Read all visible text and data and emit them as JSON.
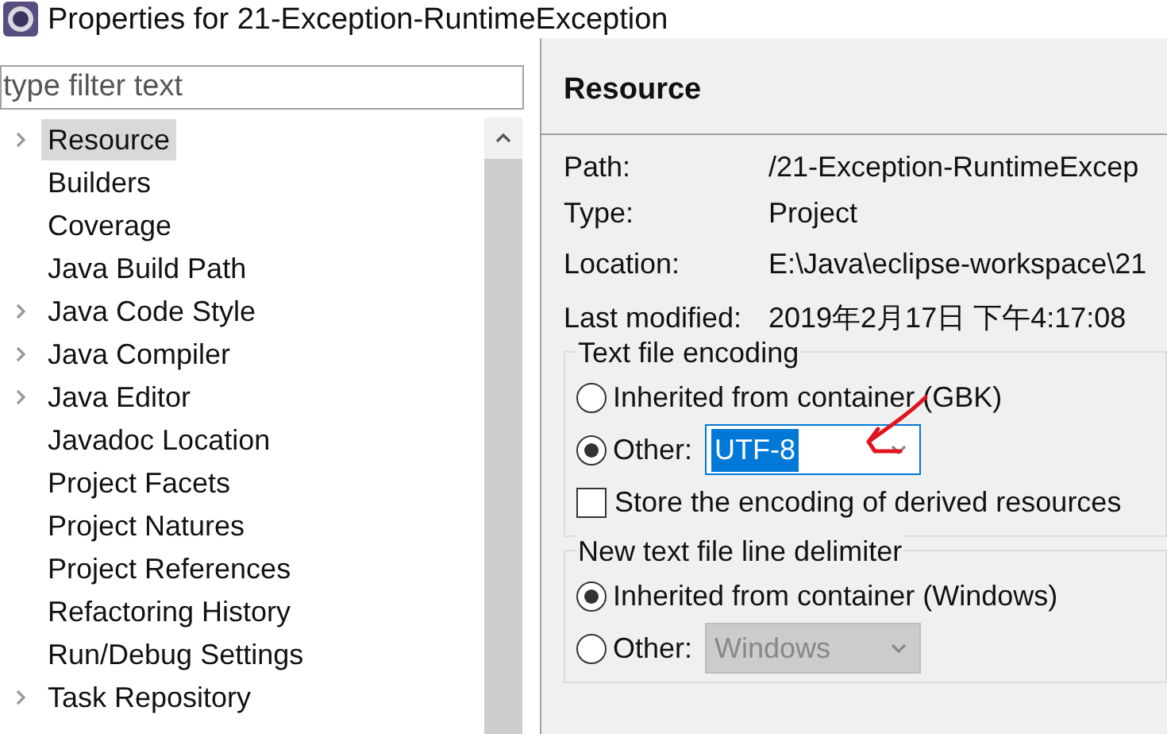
{
  "window": {
    "title": "Properties for 21-Exception-RuntimeException"
  },
  "filter": {
    "placeholder": "type filter text"
  },
  "tree": {
    "items": [
      {
        "label": "Resource",
        "expandable": true,
        "selected": true
      },
      {
        "label": "Builders",
        "expandable": false,
        "selected": false
      },
      {
        "label": "Coverage",
        "expandable": false,
        "selected": false
      },
      {
        "label": "Java Build Path",
        "expandable": false,
        "selected": false
      },
      {
        "label": "Java Code Style",
        "expandable": true,
        "selected": false
      },
      {
        "label": "Java Compiler",
        "expandable": true,
        "selected": false
      },
      {
        "label": "Java Editor",
        "expandable": true,
        "selected": false
      },
      {
        "label": "Javadoc Location",
        "expandable": false,
        "selected": false
      },
      {
        "label": "Project Facets",
        "expandable": false,
        "selected": false
      },
      {
        "label": "Project Natures",
        "expandable": false,
        "selected": false
      },
      {
        "label": "Project References",
        "expandable": false,
        "selected": false
      },
      {
        "label": "Refactoring History",
        "expandable": false,
        "selected": false
      },
      {
        "label": "Run/Debug Settings",
        "expandable": false,
        "selected": false
      },
      {
        "label": "Task Repository",
        "expandable": true,
        "selected": false
      }
    ]
  },
  "page": {
    "title": "Resource",
    "properties": [
      {
        "label": "Path:",
        "value": "/21-Exception-RuntimeExcep"
      },
      {
        "label": "Type:",
        "value": "Project"
      },
      {
        "label": "Location:",
        "value": "E:\\Java\\eclipse-workspace\\21"
      },
      {
        "label": "Last modified:",
        "value": "2019年2月17日 下午4:17:08"
      }
    ],
    "groups": [
      {
        "title": "Text file encoding",
        "options": [
          {
            "label": "Inherited from container (GBK)",
            "selected": false
          },
          {
            "label": "Other:",
            "selected": true,
            "combo": {
              "value": "UTF-8",
              "disabled": false
            }
          }
        ],
        "checkbox": {
          "label": "Store the encoding of derived resources",
          "checked": false
        }
      },
      {
        "title": "New text file line delimiter",
        "options": [
          {
            "label": "Inherited from container (Windows)",
            "selected": true
          },
          {
            "label": "Other:",
            "selected": false,
            "combo": {
              "value": "Windows",
              "disabled": true
            }
          }
        ]
      }
    ]
  }
}
